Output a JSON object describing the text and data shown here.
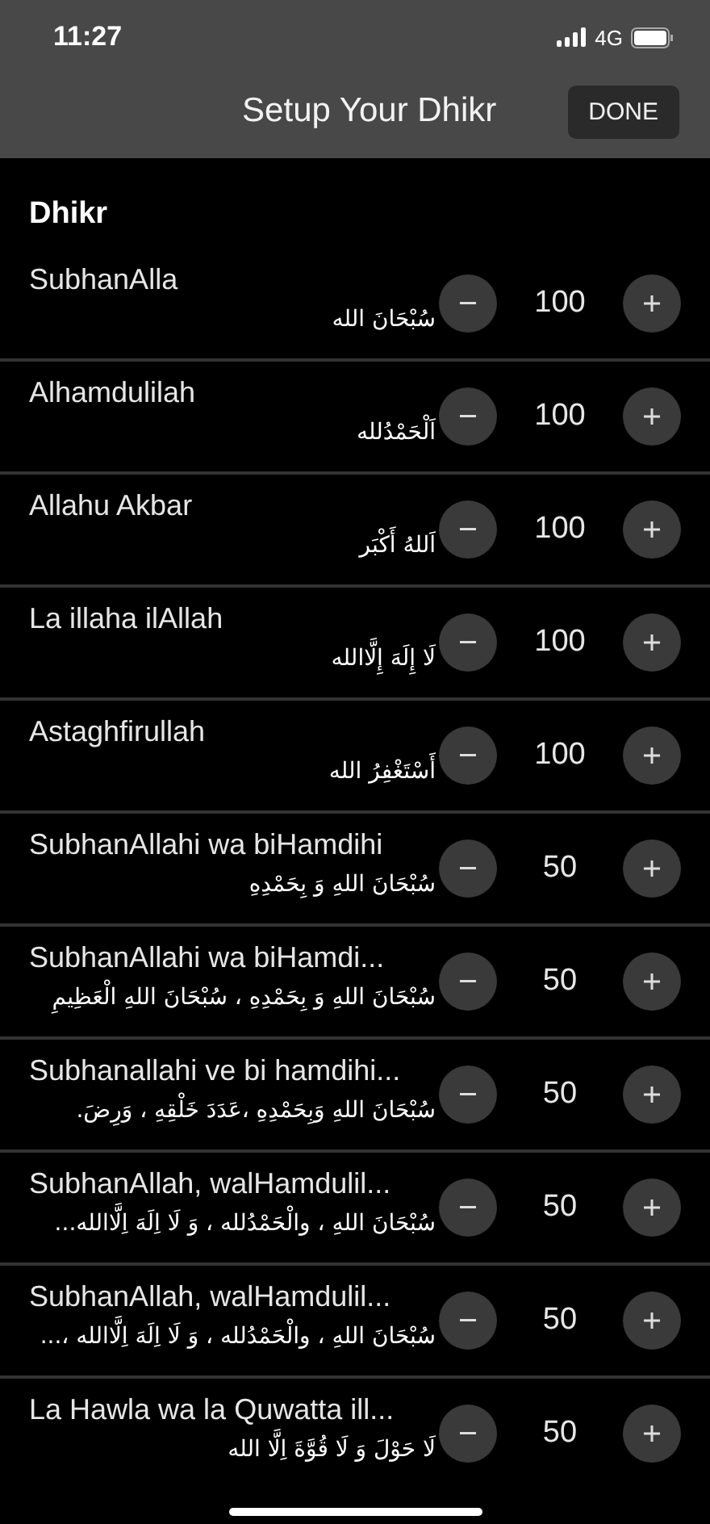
{
  "status_bar": {
    "time": "11:27",
    "network": "4G"
  },
  "header": {
    "title": "Setup Your Dhikr",
    "done_button": "DONE"
  },
  "section": {
    "title": "Dhikr"
  },
  "dhikr": [
    {
      "name": "SubhanAlla",
      "arabic": "سُبْحَانَ الله",
      "count": "100"
    },
    {
      "name": "Alhamdulilah",
      "arabic": "اَلْحَمْدُلله",
      "count": "100"
    },
    {
      "name": "Allahu Akbar",
      "arabic": "اَللهُ أَكْبَر",
      "count": "100"
    },
    {
      "name": "La illaha ilAllah",
      "arabic": "لَا إِلَهَ إِلَّاالله",
      "count": "100"
    },
    {
      "name": "Astaghfirullah",
      "arabic": "أَسْتَغْفِرُ الله",
      "count": "100"
    },
    {
      "name": "SubhanAllahi wa biHamdihi",
      "arabic": "سُبْحَانَ اللهِ وَ بِحَمْدِهِ",
      "count": "50"
    },
    {
      "name": "SubhanAllahi wa biHamdi...",
      "arabic": "سُبْحَانَ اللهِ وَ بِحَمْدِهِ ، سُبْحَانَ اللهِ الْعَظِيمِ",
      "count": "50"
    },
    {
      "name": "Subhanallahi ve bi hamdihi...",
      "arabic": "سُبْحَانَ اللهِ وَبِحَمْدِهِ ،عَدَدَ خَلْقِهِ ، وَرِضَ.",
      "count": "50"
    },
    {
      "name": "SubhanAllah, walHamdulil...",
      "arabic": "سُبْحَانَ اللهِ ، والْحَمْدُلله ، وَ لَا اِلَهَ اِلَّاالله...",
      "count": "50"
    },
    {
      "name": "SubhanAllah, walHamdulil...",
      "arabic": "سُبْحَانَ اللهِ ، والْحَمْدُلله ، وَ لَا اِلَهَ اِلَّاالله ،...",
      "count": "50"
    },
    {
      "name": "La Hawla wa la Quwatta ill...",
      "arabic": "لَا حَوْلَ وَ لَا قُوَّةَ اِلَّا الله",
      "count": "50"
    }
  ]
}
